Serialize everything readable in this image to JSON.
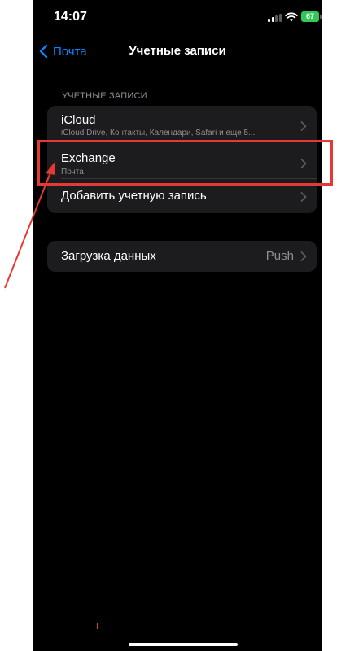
{
  "status_bar": {
    "time": "14:07",
    "battery": "67"
  },
  "nav": {
    "back_label": "Почта",
    "title": "Учетные записи"
  },
  "accounts_section": {
    "header": "УЧЕТНЫЕ ЗАПИСИ",
    "items": [
      {
        "title": "iCloud",
        "subtitle": "iCloud Drive, Контакты, Календари, Safari и еще 5..."
      },
      {
        "title": "Exchange",
        "subtitle": "Почта"
      },
      {
        "title": "Добавить учетную запись"
      }
    ]
  },
  "fetch_section": {
    "title": "Загрузка данных",
    "value": "Push"
  },
  "colors": {
    "background": "#000000",
    "cell_background": "#1c1c1e",
    "accent": "#0a84ff",
    "secondary_text": "#8e8e93",
    "annotation": "#e53935",
    "battery": "#33c759"
  },
  "icons": {
    "back": "chevron-left-icon",
    "disclosure": "chevron-right-icon",
    "signal": "cellular-signal-icon",
    "wifi": "wifi-icon",
    "battery": "battery-icon"
  }
}
